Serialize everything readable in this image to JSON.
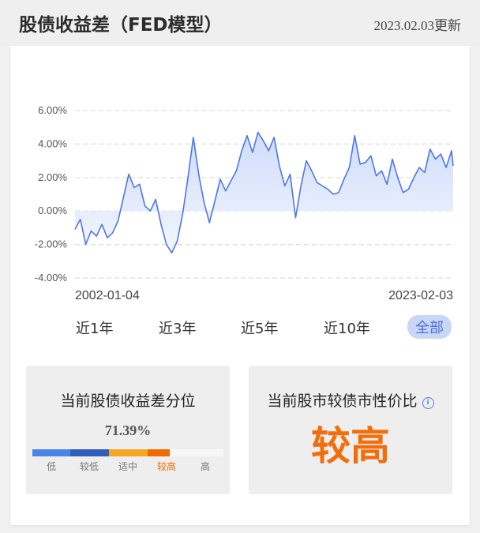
{
  "header": {
    "title": "股债收益差（FED模型）",
    "updated": "2023.02.03更新"
  },
  "chart_data": {
    "type": "area",
    "title": "",
    "xlabel": "",
    "ylabel": "",
    "ylim": [
      -4,
      6
    ],
    "yticks": [
      6,
      4,
      2,
      0,
      -2,
      -4
    ],
    "ytick_labels": [
      "6.00%",
      "4.00%",
      "2.00%",
      "0.00%",
      "-2.00%",
      "-4.00%"
    ],
    "x_start_label": "2002-01-04",
    "x_end_label": "2023-02-03",
    "grid": true,
    "colors": {
      "line": "#4f77e6",
      "fill_top": "#cfdcfb",
      "fill_bottom": "#f3f6fe",
      "grid": "#dddddd"
    },
    "x": [
      2002.0,
      2002.3,
      2002.6,
      2002.9,
      2003.2,
      2003.5,
      2003.8,
      2004.1,
      2004.4,
      2004.7,
      2005.0,
      2005.3,
      2005.6,
      2005.9,
      2006.2,
      2006.5,
      2006.8,
      2007.1,
      2007.4,
      2007.7,
      2008.0,
      2008.3,
      2008.6,
      2008.9,
      2009.2,
      2009.5,
      2009.8,
      2010.1,
      2010.4,
      2010.7,
      2011.0,
      2011.3,
      2011.6,
      2011.9,
      2012.2,
      2012.5,
      2012.8,
      2013.1,
      2013.4,
      2013.7,
      2014.0,
      2014.3,
      2014.6,
      2014.9,
      2015.2,
      2015.5,
      2015.8,
      2016.1,
      2016.4,
      2016.7,
      2017.0,
      2017.3,
      2017.6,
      2017.9,
      2018.2,
      2018.5,
      2018.8,
      2019.1,
      2019.4,
      2019.7,
      2020.0,
      2020.3,
      2020.6,
      2020.9,
      2021.2,
      2021.5,
      2021.8,
      2022.1,
      2022.4,
      2022.7,
      2023.0,
      2023.09
    ],
    "values": [
      -1.1,
      -0.5,
      -2.0,
      -1.2,
      -1.5,
      -0.8,
      -1.6,
      -1.3,
      -0.6,
      0.8,
      2.2,
      1.4,
      1.6,
      0.3,
      0.0,
      0.7,
      -0.8,
      -2.0,
      -2.5,
      -1.8,
      -0.2,
      2.0,
      4.4,
      2.2,
      0.5,
      -0.7,
      0.6,
      1.9,
      1.2,
      1.8,
      2.4,
      3.6,
      4.5,
      3.5,
      4.7,
      4.2,
      3.6,
      4.4,
      2.7,
      1.5,
      2.2,
      -0.4,
      1.5,
      3.0,
      2.4,
      1.7,
      1.5,
      1.3,
      1.0,
      1.1,
      1.9,
      2.6,
      4.5,
      2.8,
      2.9,
      3.3,
      2.1,
      2.4,
      1.6,
      3.1,
      2.0,
      1.1,
      1.3,
      2.0,
      2.6,
      2.3,
      3.7,
      3.1,
      3.4,
      2.6,
      3.6,
      2.7
    ]
  },
  "ranges": [
    "近1年",
    "近3年",
    "近5年",
    "近10年",
    "全部"
  ],
  "active_range": "全部",
  "left_panel": {
    "title": "当前股债收益差分位",
    "percentile": "71.39%",
    "percentile_value": 71.39,
    "segments": [
      {
        "label": "低",
        "color": "#4a84e8"
      },
      {
        "label": "较低",
        "color": "#2f5fb8"
      },
      {
        "label": "适中",
        "color": "#f5a623"
      },
      {
        "label": "较高",
        "color": "#f06a00"
      },
      {
        "label": "高",
        "color": "#f7f7f7"
      }
    ],
    "active_segment": "较高"
  },
  "right_panel": {
    "title": "当前股市较债市性价比",
    "info_icon": "i",
    "verdict": "较高"
  }
}
